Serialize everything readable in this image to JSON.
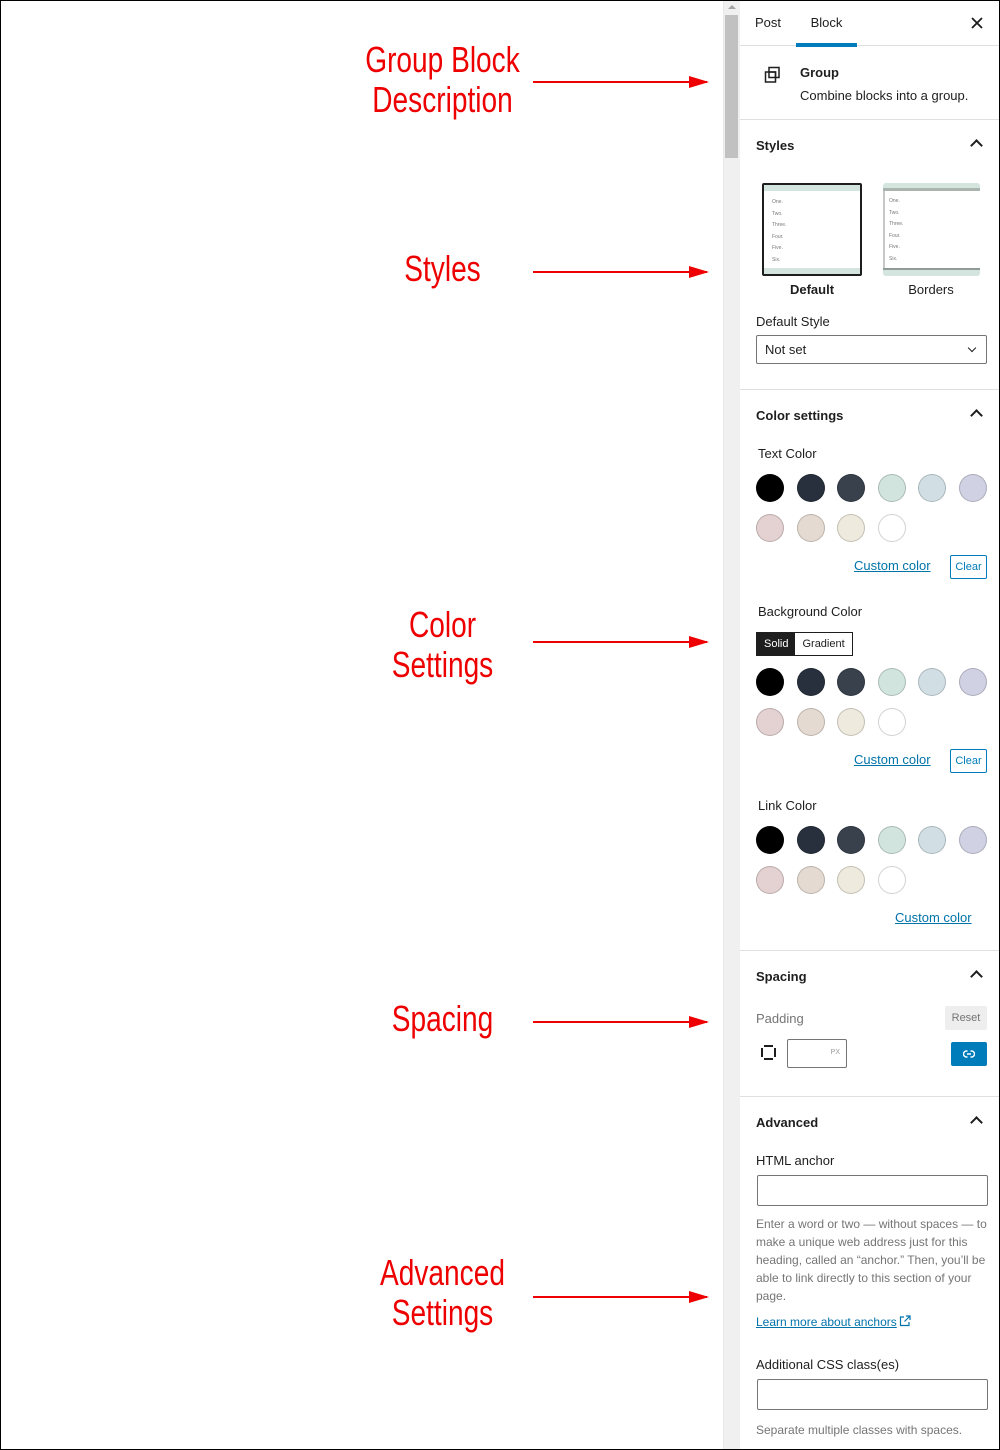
{
  "annotations": [
    {
      "label_line1": "Group Block",
      "label_line2": "Description"
    },
    {
      "label_line1": "Styles",
      "label_line2": ""
    },
    {
      "label_line1": "Color",
      "label_line2": "Settings"
    },
    {
      "label_line1": "Spacing",
      "label_line2": ""
    },
    {
      "label_line1": "Advanced",
      "label_line2": "Settings"
    }
  ],
  "annotation_color": "#ee0000",
  "sidebar": {
    "tabs": [
      {
        "label": "Post",
        "active": false
      },
      {
        "label": "Block",
        "active": true
      }
    ],
    "close_icon": "close-icon",
    "block": {
      "icon": "group-icon",
      "title": "Group",
      "description": "Combine blocks into a group."
    },
    "styles": {
      "title": "Styles",
      "options": [
        {
          "label": "Default",
          "selected": true,
          "preview_lines": [
            "One.",
            "Two.",
            "Three.",
            "Four.",
            "Five.",
            "Six."
          ]
        },
        {
          "label": "Borders",
          "selected": false,
          "preview_lines": [
            "One.",
            "Two.",
            "Three.",
            "Four.",
            "Five.",
            "Six."
          ]
        }
      ],
      "default_style_label": "Default Style",
      "default_style_value": "Not set"
    },
    "color_settings": {
      "title": "Color settings",
      "palette": [
        "#000000",
        "#28303d",
        "#39414d",
        "#d1e4dd",
        "#d1dfe4",
        "#d1d1e4",
        "#e4d1d1",
        "#e4dad1",
        "#eeeadd",
        "#ffffff"
      ],
      "text_color": {
        "label": "Text Color",
        "custom_label": "Custom color",
        "clear_label": "Clear"
      },
      "background_color": {
        "label": "Background Color",
        "tabs": [
          "Solid",
          "Gradient"
        ],
        "active_tab": "Solid",
        "custom_label": "Custom color",
        "clear_label": "Clear"
      },
      "link_color": {
        "label": "Link Color",
        "custom_label": "Custom color"
      }
    },
    "spacing": {
      "title": "Spacing",
      "padding_label": "Padding",
      "reset_label": "Reset",
      "padding_value": "",
      "unit": "PX"
    },
    "advanced": {
      "title": "Advanced",
      "anchor_label": "HTML anchor",
      "anchor_value": "",
      "anchor_help": "Enter a word or two — without spaces — to make a unique web address just for this heading, called an “anchor.” Then, you’ll be able to link directly to this section of your page.",
      "learn_more": "Learn more about anchors",
      "css_label": "Additional CSS class(es)",
      "css_value": "",
      "css_help": "Separate multiple classes with spaces."
    }
  }
}
